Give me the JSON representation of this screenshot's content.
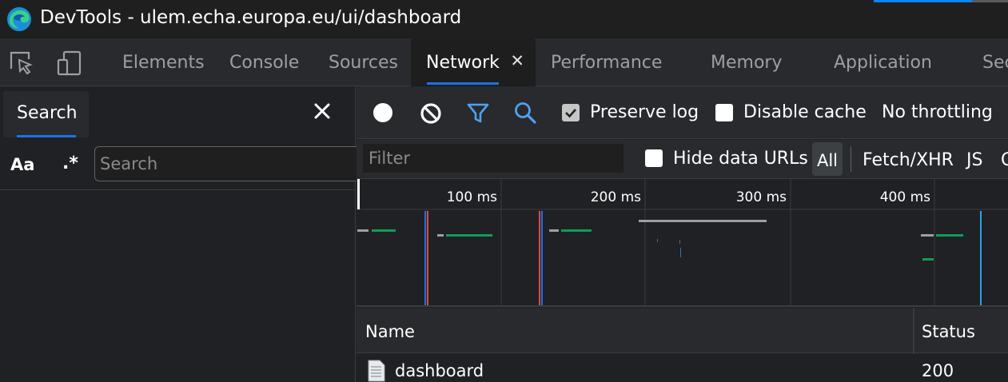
{
  "window": {
    "title": "DevTools - ulem.echa.europa.eu/ui/dashboard"
  },
  "tabs": [
    {
      "label": "Elements"
    },
    {
      "label": "Console"
    },
    {
      "label": "Sources"
    },
    {
      "label": "Network",
      "close": "✕"
    },
    {
      "label": "Performance"
    },
    {
      "label": "Memory"
    },
    {
      "label": "Application"
    },
    {
      "label": "Sec"
    }
  ],
  "search_pane": {
    "tab_label": "Search",
    "match_case": "Aa",
    "regex": ".*",
    "input_placeholder": "Search",
    "input_value": ""
  },
  "network_toolbar": {
    "preserve_log": {
      "label": "Preserve log",
      "checked": true
    },
    "disable_cache": {
      "label": "Disable cache",
      "checked": false
    },
    "throttling": "No throttling"
  },
  "filter_bar": {
    "placeholder": "Filter",
    "hide_data_urls": {
      "label": "Hide data URLs",
      "checked": false
    },
    "types": [
      "All",
      "Fetch/XHR",
      "JS",
      "C"
    ]
  },
  "timeline": {
    "ticks": [
      "100 ms",
      "200 ms",
      "300 ms",
      "400 ms"
    ]
  },
  "table": {
    "columns": [
      "Name",
      "Status"
    ],
    "rows": [
      {
        "name": "dashboard",
        "status": "200"
      }
    ]
  },
  "colors": {
    "accent": "#1a73e8",
    "waiting": "#9aa0a6",
    "download": "#0f9d58",
    "dom_content_loaded": "#1a73e8",
    "load": "#e8453c"
  }
}
